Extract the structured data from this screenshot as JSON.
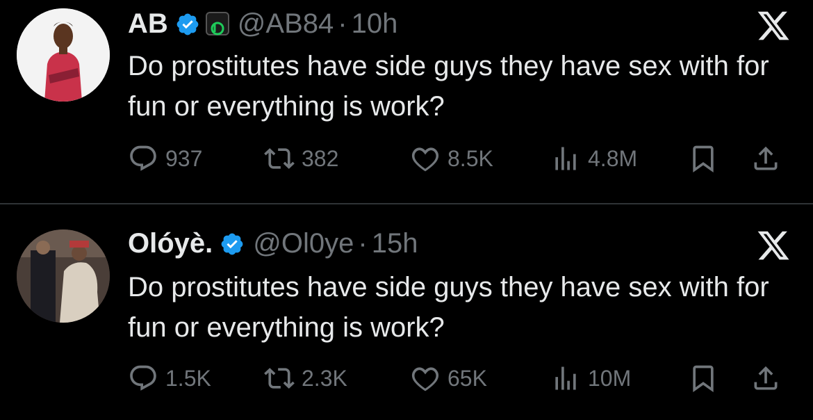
{
  "tweets": [
    {
      "name": "AB",
      "handle": "@AB84",
      "separator": "·",
      "time": "10h",
      "text": "Do prostitutes have side guys they have sex with for fun or everything is work?",
      "stats": {
        "replies": "937",
        "retweets": "382",
        "likes": "8.5K",
        "views": "4.8M"
      },
      "verified": true,
      "affiliate_badge": "b-icon"
    },
    {
      "name": "Olóyè.",
      "handle": "@Ol0ye",
      "separator": "·",
      "time": "15h",
      "text": "Do prostitutes have side guys they have sex with for fun or everything is work?",
      "stats": {
        "replies": "1.5K",
        "retweets": "2.3K",
        "likes": "65K",
        "views": "10M"
      },
      "verified": true
    }
  ],
  "colors": {
    "background": "#000000",
    "text": "#e7e9ea",
    "muted": "#71767b",
    "verified": "#1d9bf0",
    "divider": "#2f3336"
  }
}
